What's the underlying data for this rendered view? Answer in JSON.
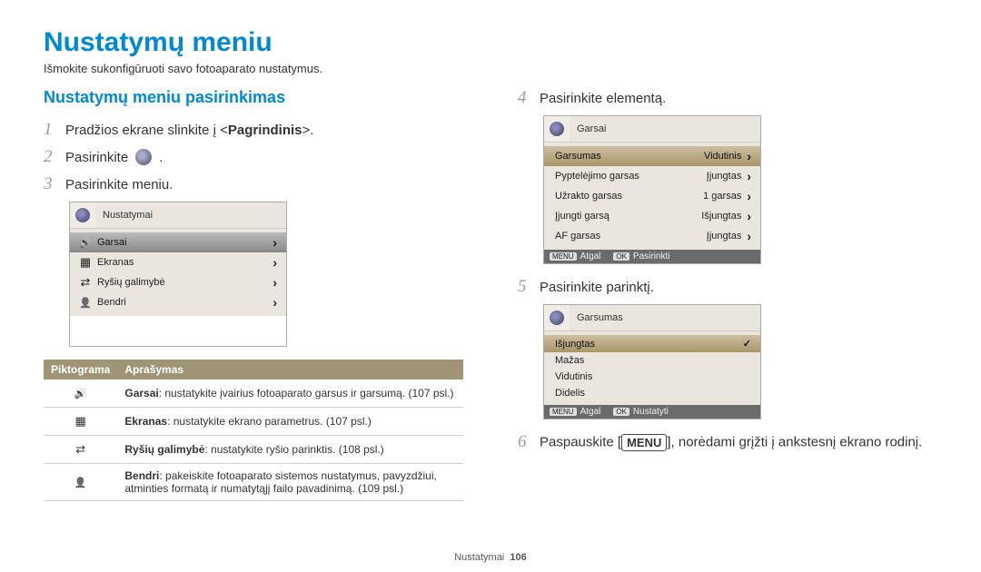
{
  "page": {
    "title": "Nustatymų meniu",
    "subtitle": "Išmokite sukonfigūruoti savo fotoaparato nustatymus.",
    "footer": "Nustatymai",
    "page_num": "106"
  },
  "left": {
    "section_title": "Nustatymų meniu pasirinkimas",
    "steps": {
      "s1": "Pradžios ekrane slinkite į <Pagrindinis>.",
      "s2": "Pasirinkite",
      "s3": "Pasirinkite meniu."
    },
    "panel1": {
      "header": "Nustatymai",
      "items": [
        {
          "label": "Garsai"
        },
        {
          "label": "Ekranas"
        },
        {
          "label": "Ryšių galimybė"
        },
        {
          "label": "Bendri"
        }
      ]
    },
    "table": {
      "h1": "Piktograma",
      "h2": "Aprašymas",
      "rows": [
        {
          "b": "Garsai",
          "t": ": nustatykite įvairius fotoaparato garsus ir garsumą. (107 psl.)"
        },
        {
          "b": "Ekranas",
          "t": ": nustatykite ekrano parametrus. (107 psl.)"
        },
        {
          "b": "Ryšių galimybė",
          "t": ": nustatykite ryšio parinktis. (108 psl.)"
        },
        {
          "b": "Bendri",
          "t": ": pakeiskite fotoaparato sistemos nustatymus, pavyzdžiui, atminties formatą ir numatytąjį failo pavadinimą. (109 psl.)"
        }
      ]
    }
  },
  "right": {
    "s4": "Pasirinkite elementą.",
    "s5": "Pasirinkite parinktį.",
    "s6_a": "Paspauskite [",
    "s6_b": "], norėdami grįžti į ankstesnį ekrano rodinį.",
    "menu_btn": "MENU",
    "panel2": {
      "header": "Garsai",
      "rows": [
        {
          "label": "Garsumas",
          "val": "Vidutinis"
        },
        {
          "label": "Pyptelėjimo garsas",
          "val": "Įjungtas"
        },
        {
          "label": "Užrakto garsas",
          "val": "1 garsas"
        },
        {
          "label": "Įjungti garsą",
          "val": "Išjungtas"
        },
        {
          "label": "AF garsas",
          "val": "Įjungtas"
        }
      ],
      "footer_menu": "MENU",
      "footer_back": "Atgal",
      "footer_ok": "OK",
      "footer_sel": "Pasirinkti"
    },
    "panel3": {
      "header": "Garsumas",
      "rows": [
        {
          "label": "Išjungtas"
        },
        {
          "label": "Mažas"
        },
        {
          "label": "Vidutinis"
        },
        {
          "label": "Didelis"
        }
      ],
      "footer_menu": "MENU",
      "footer_back": "Atgal",
      "footer_ok": "OK",
      "footer_set": "Nustatyti"
    }
  }
}
